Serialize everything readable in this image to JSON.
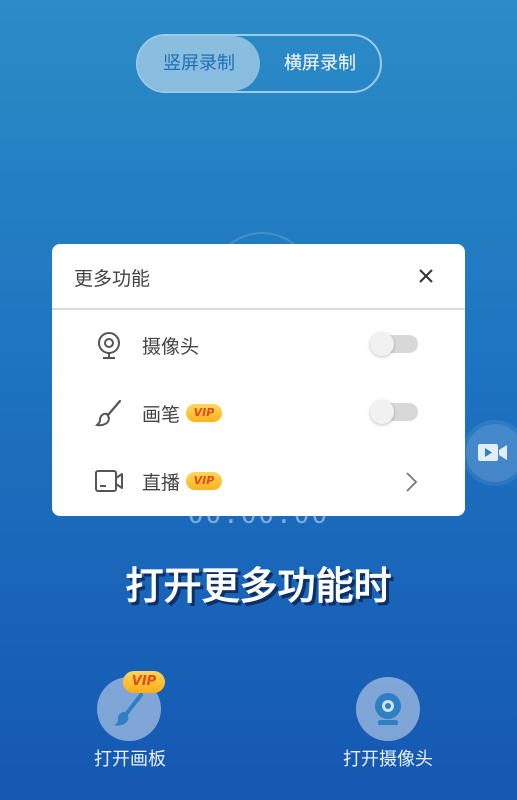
{
  "mode_switch": {
    "portrait": "竖屏录制",
    "landscape": "横屏录制"
  },
  "timer": "00:00:00",
  "headline": "打开更多功能时",
  "dialog": {
    "title": "更多功能",
    "items": [
      {
        "label": "摄像头",
        "icon": "webcam-icon",
        "control": "toggle",
        "state": "off"
      },
      {
        "label": "画笔",
        "icon": "brush-icon",
        "badge": "VIP",
        "control": "toggle",
        "state": "off"
      },
      {
        "label": "直播",
        "icon": "video-camera-icon",
        "badge": "VIP",
        "control": "chevron"
      }
    ]
  },
  "bottom": {
    "draw_board_label": "打开画板",
    "draw_board_badge": "VIP",
    "camera_label": "打开摄像头"
  },
  "colors": {
    "background_top": "#2b8cc6",
    "background_bottom": "#1557b2",
    "vip_badge": "#ffc93c",
    "vip_text": "#e24a17"
  }
}
